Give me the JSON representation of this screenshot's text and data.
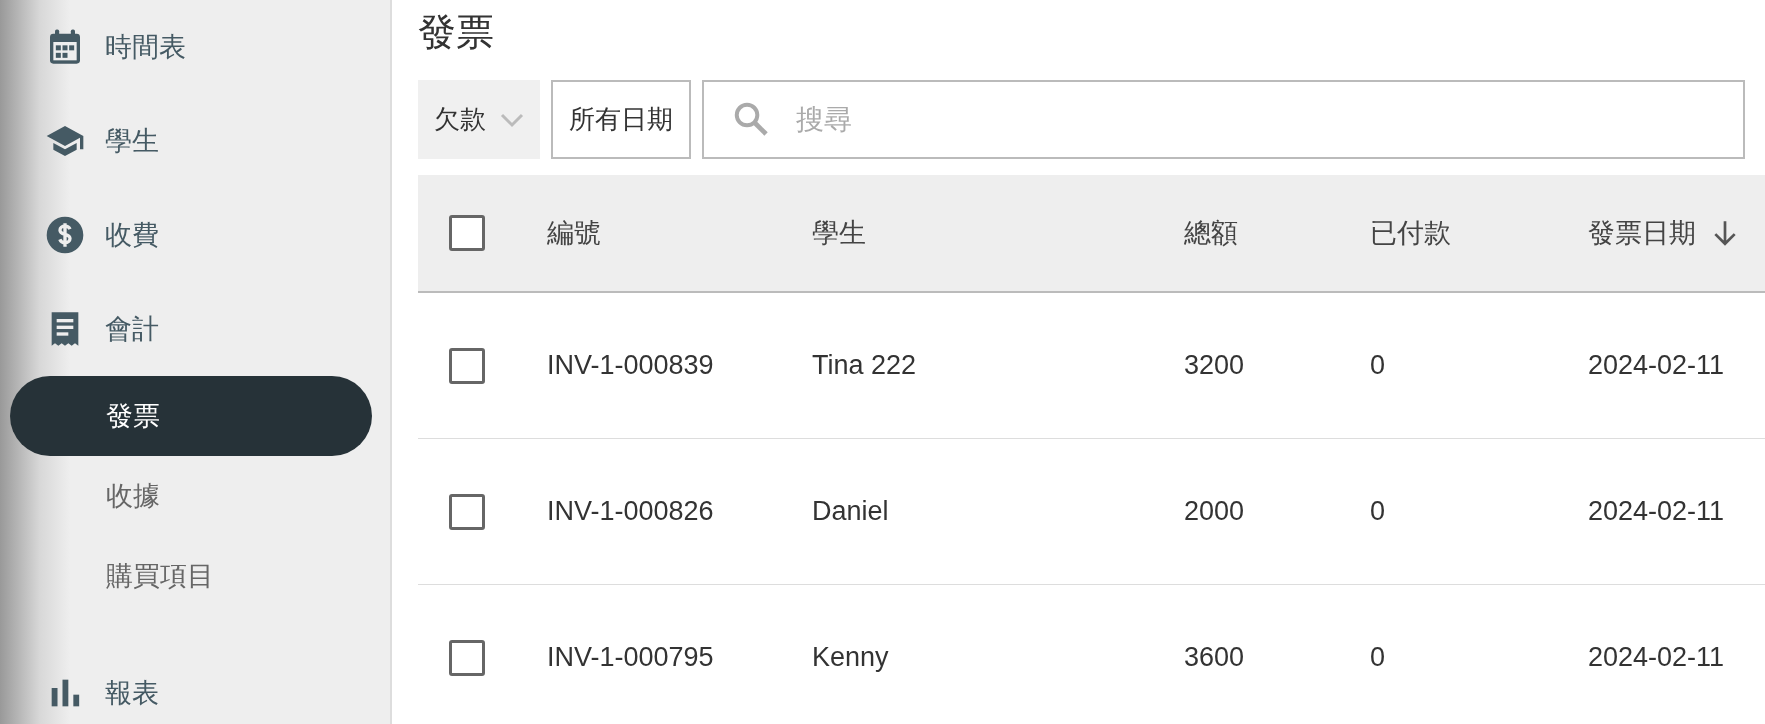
{
  "sidebar": {
    "items": [
      {
        "label": "時間表",
        "kind": "section",
        "selected": false
      },
      {
        "label": "學生",
        "kind": "section",
        "selected": false
      },
      {
        "label": "收費",
        "kind": "section",
        "selected": false
      },
      {
        "label": "會計",
        "kind": "section",
        "selected": false
      },
      {
        "label": "發票",
        "kind": "sub",
        "selected": true
      },
      {
        "label": "收據",
        "kind": "sub",
        "selected": false
      },
      {
        "label": "購買項目",
        "kind": "sub",
        "selected": false
      },
      {
        "label": "報表",
        "kind": "section",
        "selected": false
      }
    ]
  },
  "page_title": "發票",
  "filters": {
    "status": "欠款",
    "date": "所有日期",
    "search": {
      "placeholder": "搜尋"
    }
  },
  "table": {
    "select_all": {
      "checked": false
    },
    "columns": [
      {
        "label": "編號"
      },
      {
        "label": "學生"
      },
      {
        "label": "總額"
      },
      {
        "label": "已付款"
      },
      {
        "label": "發票日期",
        "sorted_descending": true
      }
    ],
    "rows": [
      {
        "checked": false,
        "cells": [
          "INV-1-000839",
          "Tina 222",
          "3200",
          "0",
          "2024-02-11"
        ]
      },
      {
        "checked": false,
        "cells": [
          "INV-1-000826",
          "Daniel",
          "2000",
          "0",
          "2024-02-11"
        ]
      },
      {
        "checked": false,
        "cells": [
          "INV-1-000795",
          "Kenny",
          "3600",
          "0",
          "2024-02-11"
        ]
      }
    ]
  }
}
